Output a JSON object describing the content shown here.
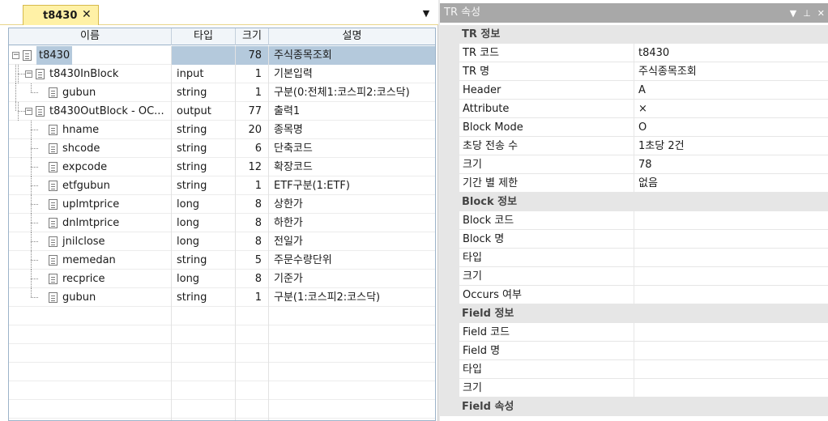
{
  "tab": {
    "title": "t8430"
  },
  "columns": [
    "이름",
    "타입",
    "크기",
    "설명"
  ],
  "rows": [
    {
      "name": "t8430",
      "type": "",
      "size": "78",
      "desc": "주식종목조회"
    },
    {
      "name": "t8430InBlock",
      "type": "input",
      "size": "1",
      "desc": "기본입력"
    },
    {
      "name": "gubun",
      "type": "string",
      "size": "1",
      "desc": "구분(0:전체1:코스피2:코스닥)"
    },
    {
      "name": "t8430OutBlock - OC...",
      "type": "output",
      "size": "77",
      "desc": "출력1"
    },
    {
      "name": "hname",
      "type": "string",
      "size": "20",
      "desc": "종목명"
    },
    {
      "name": "shcode",
      "type": "string",
      "size": "6",
      "desc": "단축코드"
    },
    {
      "name": "expcode",
      "type": "string",
      "size": "12",
      "desc": "확장코드"
    },
    {
      "name": "etfgubun",
      "type": "string",
      "size": "1",
      "desc": "ETF구분(1:ETF)"
    },
    {
      "name": "uplmtprice",
      "type": "long",
      "size": "8",
      "desc": "상한가"
    },
    {
      "name": "dnlmtprice",
      "type": "long",
      "size": "8",
      "desc": "하한가"
    },
    {
      "name": "jnilclose",
      "type": "long",
      "size": "8",
      "desc": "전일가"
    },
    {
      "name": "memedan",
      "type": "string",
      "size": "5",
      "desc": "주문수량단위"
    },
    {
      "name": "recprice",
      "type": "long",
      "size": "8",
      "desc": "기준가"
    },
    {
      "name": "gubun",
      "type": "string",
      "size": "1",
      "desc": "구분(1:코스피2:코스닥)"
    }
  ],
  "panel": {
    "title": "TR 속성",
    "tr_category": "TR 정보",
    "tr_props": [
      {
        "name": "TR 코드",
        "value": "t8430"
      },
      {
        "name": "TR 명",
        "value": "주식종목조회"
      },
      {
        "name": "Header",
        "value": "A"
      },
      {
        "name": "Attribute",
        "value": "×"
      },
      {
        "name": "Block Mode",
        "value": "O"
      },
      {
        "name": "초당 전송 수",
        "value": "1초당 2건"
      },
      {
        "name": "크기",
        "value": "78"
      },
      {
        "name": "기간 별 제한",
        "value": "없음"
      }
    ],
    "block_category": "Block 정보",
    "block_props": [
      {
        "name": "Block 코드",
        "value": ""
      },
      {
        "name": "Block 명",
        "value": ""
      },
      {
        "name": "타입",
        "value": ""
      },
      {
        "name": "크기",
        "value": ""
      },
      {
        "name": "Occurs 여부",
        "value": ""
      }
    ],
    "field_category": "Field 정보",
    "field_props": [
      {
        "name": "Field 코드",
        "value": ""
      },
      {
        "name": "Field 명",
        "value": ""
      },
      {
        "name": "타입",
        "value": ""
      },
      {
        "name": "크기",
        "value": ""
      }
    ],
    "field_attr_category": "Field 속성"
  }
}
